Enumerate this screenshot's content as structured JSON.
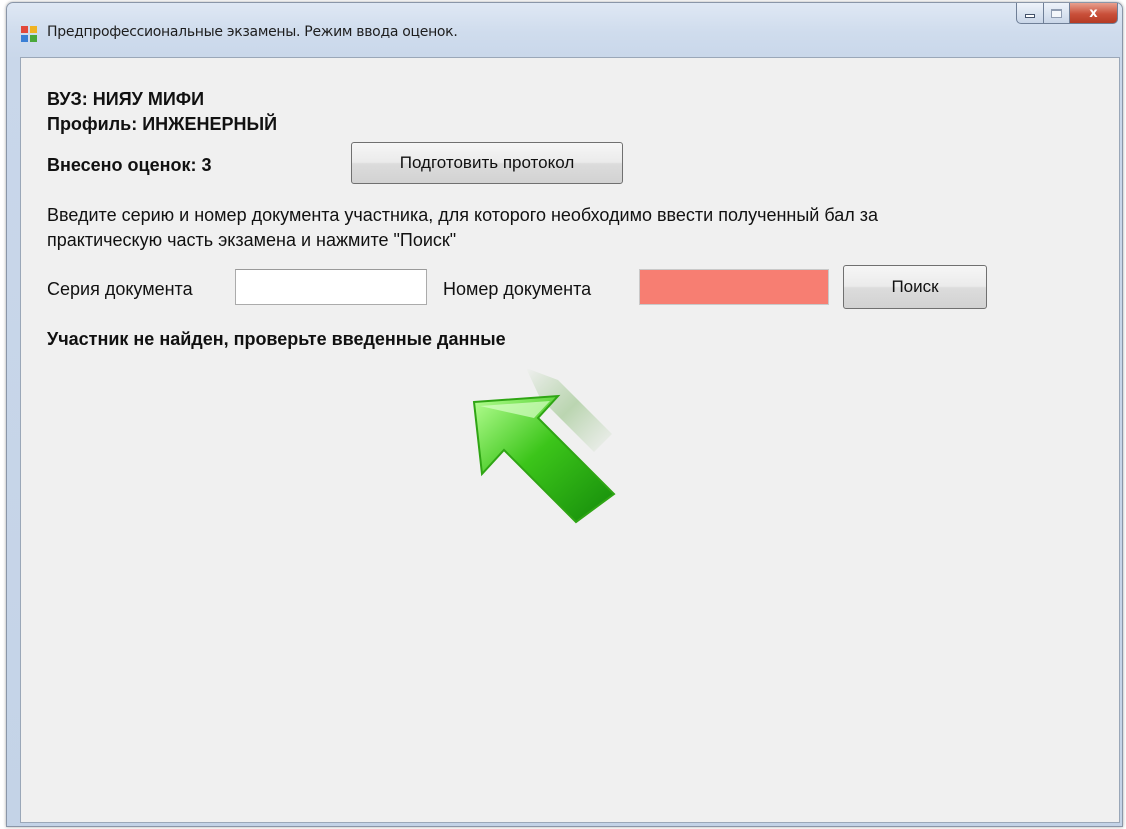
{
  "window": {
    "title": "Предпрофессиональные экзамены. Режим ввода оценок.",
    "icon": "app-icon",
    "controls": [
      "minimize-icon",
      "maximize-icon",
      "close-icon"
    ],
    "close_glyph": "x"
  },
  "info": {
    "university": "ВУЗ: НИЯУ МИФИ",
    "profile": "Профиль: ИНЖЕНЕРНЫЙ",
    "grades_entered": "Внесено оценок: 3"
  },
  "actions": {
    "prepare_protocol": "Подготовить протокол",
    "search": "Поиск"
  },
  "instructions": {
    "line1": "Введите серию и номер документа участника, для которого необходимо ввести полученный бал за",
    "line2": "практическую часть экзамена и нажмите \"Поиск\""
  },
  "form": {
    "series_label": "Серия документа",
    "series_value": "",
    "number_label": "Номер документа",
    "number_value": ""
  },
  "status": {
    "message": "Участник не найден, проверьте введенные данные"
  },
  "colors": {
    "client_background": "#f0f0f0",
    "error_field": "#f77e72",
    "arrow_green": "#3cc51a"
  }
}
